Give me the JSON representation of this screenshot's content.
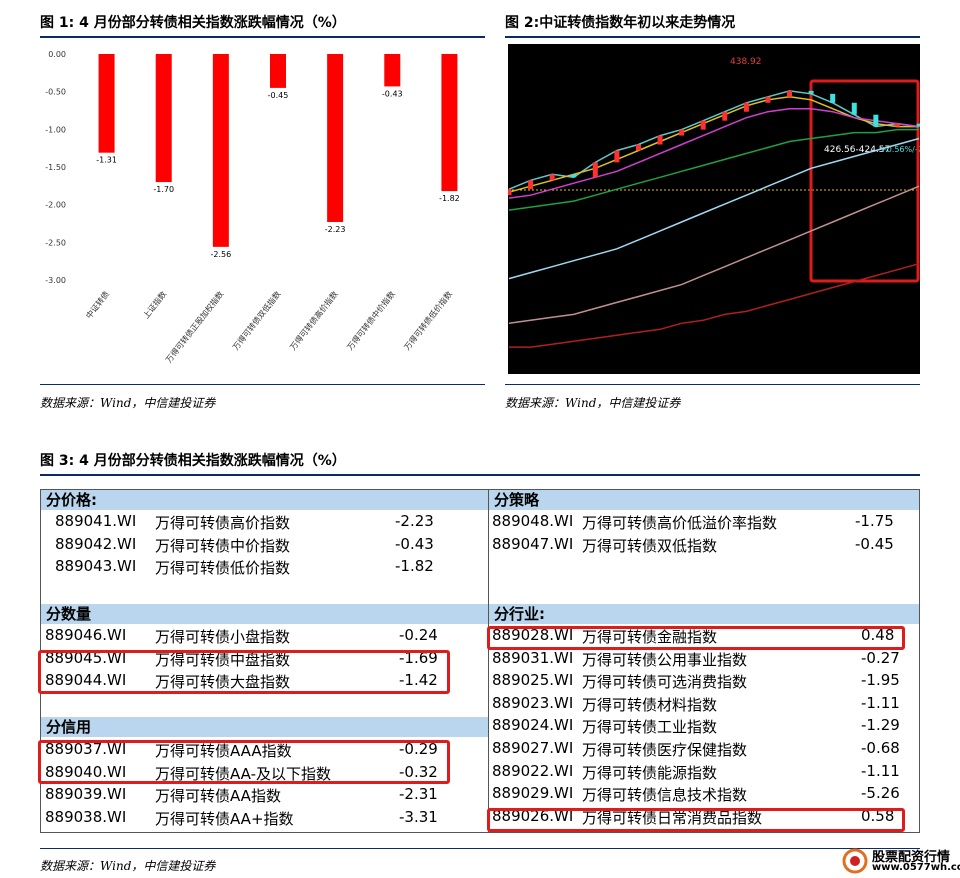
{
  "fig1": {
    "title": "图 1: 4 月份部分转债相关指数涨跌幅情况（%）",
    "source": "数据来源：Wind，中信建投证券"
  },
  "fig2": {
    "title": "图 2:中证转债指数年初以来走势情况",
    "source": "数据来源：Wind，中信建投证券",
    "label_high": "438.92",
    "label_mid": "426.56-424.57",
    "label_pct": "+0.56%/-2.3"
  },
  "fig3": {
    "title": "图 3: 4 月份部分转债相关指数涨跌幅情况（%）",
    "source": "数据来源：Wind，中信建投证券",
    "sections": {
      "price": {
        "title": "分价格:",
        "rows": [
          {
            "code": "889041.WI",
            "name": "万得可转债高价指数",
            "value": "-2.23"
          },
          {
            "code": "889042.WI",
            "name": "万得可转债中价指数",
            "value": "-0.43"
          },
          {
            "code": "889043.WI",
            "name": "万得可转债低价指数",
            "value": "-1.82"
          }
        ]
      },
      "strategy": {
        "title": "分策略",
        "rows": [
          {
            "code": "889048.WI",
            "name": "万得可转债高价低溢价率指数",
            "value": "-1.75"
          },
          {
            "code": "889047.WI",
            "name": "万得可转债双低指数",
            "value": "-0.45"
          }
        ]
      },
      "size": {
        "title": "分数量",
        "rows": [
          {
            "code": "889046.WI",
            "name": "万得可转债小盘指数",
            "value": "-0.24"
          },
          {
            "code": "889045.WI",
            "name": "万得可转债中盘指数",
            "value": "-1.69"
          },
          {
            "code": "889044.WI",
            "name": "万得可转债大盘指数",
            "value": "-1.42"
          }
        ]
      },
      "credit": {
        "title": "分信用",
        "rows": [
          {
            "code": "889037.WI",
            "name": "万得可转债AAA指数",
            "value": "-0.29"
          },
          {
            "code": "889040.WI",
            "name": "万得可转债AA-及以下指数",
            "value": "-0.32"
          },
          {
            "code": "889039.WI",
            "name": "万得可转债AA指数",
            "value": "-2.31"
          },
          {
            "code": "889038.WI",
            "name": "万得可转债AA+指数",
            "value": "-3.31"
          }
        ]
      },
      "industry": {
        "title": "分行业:",
        "rows": [
          {
            "code": "889028.WI",
            "name": "万得可转债金融指数",
            "value": "0.48"
          },
          {
            "code": "889031.WI",
            "name": "万得可转债公用事业指数",
            "value": "-0.27"
          },
          {
            "code": "889025.WI",
            "name": "万得可转债可选消费指数",
            "value": "-1.95"
          },
          {
            "code": "889023.WI",
            "name": "万得可转债材料指数",
            "value": "-1.11"
          },
          {
            "code": "889024.WI",
            "name": "万得可转债工业指数",
            "value": "-1.29"
          },
          {
            "code": "889027.WI",
            "name": "万得可转债医疗保健指数",
            "value": "-0.68"
          },
          {
            "code": "889022.WI",
            "name": "万得可转债能源指数",
            "value": "-1.11"
          },
          {
            "code": "889029.WI",
            "name": "万得可转债信息技术指数",
            "value": "-5.26"
          },
          {
            "code": "889026.WI",
            "name": "万得可转债日常消费品指数",
            "value": "0.58"
          }
        ]
      }
    }
  },
  "watermark": {
    "name": "股票配资行情",
    "url": "www.0577wh.com"
  },
  "colors": {
    "bar": "#ff0000",
    "header_bg": "#b9d6ee",
    "highlight": "#e01b1b",
    "rule": "#0b2a6a"
  },
  "chart_data": [
    {
      "type": "bar",
      "categories": [
        "中证转债",
        "上证指数",
        "万得可转债正股加权指数",
        "万得可转债双低指数",
        "万得可转债高价指数",
        "万得可转债中价指数",
        "万得可转债低价指数"
      ],
      "values": [
        -1.31,
        -1.7,
        -2.56,
        -0.45,
        -2.23,
        -0.43,
        -1.82
      ],
      "value_labels": [
        "-1.31",
        "-1.70",
        "-2.56",
        "-0.45",
        "-2.23",
        "-0.43",
        "-1.82"
      ],
      "yticks": [
        "0.00",
        "-0.50",
        "-1.00",
        "-1.50",
        "-2.00",
        "-2.50",
        "-3.00"
      ],
      "ylim": [
        -3.0,
        0.0
      ],
      "grid": false,
      "legend": "none"
    },
    {
      "type": "line",
      "series": [
        {
          "color": "#5ec8c8",
          "values": [
            405,
            408,
            410,
            409,
            414,
            418,
            420,
            423,
            425,
            428,
            431,
            434,
            436,
            438,
            437,
            434,
            430,
            426,
            427,
            426
          ]
        },
        {
          "color": "#e0c020",
          "values": [
            404,
            406,
            408,
            410,
            412,
            415,
            418,
            421,
            424,
            427,
            430,
            433,
            435,
            436,
            435,
            432,
            429,
            427,
            426,
            426
          ]
        },
        {
          "color": "#d040d0",
          "values": [
            402,
            403,
            405,
            407,
            409,
            411,
            414,
            417,
            420,
            423,
            426,
            429,
            431,
            432,
            432,
            431,
            429,
            428,
            427,
            426
          ]
        },
        {
          "color": "#20a040",
          "values": [
            398,
            399,
            400,
            401,
            403,
            405,
            407,
            409,
            411,
            413,
            415,
            417,
            419,
            421,
            422,
            423,
            424,
            424,
            425,
            425
          ]
        },
        {
          "color": "#a0d8f0",
          "values": [
            375,
            377,
            379,
            381,
            383,
            385,
            388,
            391,
            394,
            397,
            400,
            403,
            406,
            409,
            412,
            414,
            416,
            418,
            420,
            422
          ]
        },
        {
          "color": "#c09090",
          "values": [
            360,
            361,
            362,
            363,
            365,
            367,
            369,
            371,
            373,
            376,
            379,
            382,
            385,
            388,
            391,
            394,
            397,
            400,
            403,
            406
          ]
        },
        {
          "color": "#b02020",
          "values": [
            352,
            352,
            353,
            354,
            355,
            356,
            357,
            358,
            360,
            361,
            363,
            364,
            366,
            368,
            370,
            372,
            374,
            376,
            378,
            380
          ]
        }
      ],
      "ylim": [
        345,
        445
      ]
    }
  ]
}
